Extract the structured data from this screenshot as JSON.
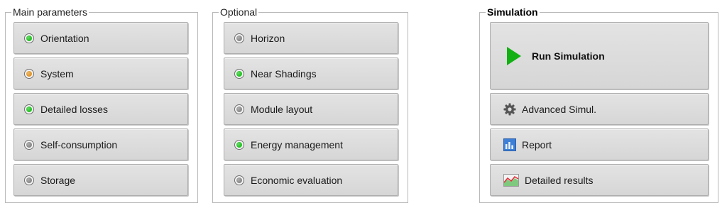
{
  "main": {
    "title": "Main parameters",
    "items": [
      {
        "label": "Orientation",
        "status": "green"
      },
      {
        "label": "System",
        "status": "orange"
      },
      {
        "label": "Detailed losses",
        "status": "green"
      },
      {
        "label": "Self-consumption",
        "status": "gray"
      },
      {
        "label": "Storage",
        "status": "gray"
      }
    ]
  },
  "optional": {
    "title": "Optional",
    "items": [
      {
        "label": "Horizon",
        "status": "gray"
      },
      {
        "label": "Near Shadings",
        "status": "green"
      },
      {
        "label": "Module layout",
        "status": "gray"
      },
      {
        "label": "Energy management",
        "status": "green"
      },
      {
        "label": "Economic evaluation",
        "status": "gray"
      }
    ]
  },
  "simulation": {
    "title": "Simulation",
    "run_label": "Run Simulation",
    "advanced_label": "Advanced Simul.",
    "report_label": "Report",
    "results_label": "Detailed results"
  },
  "colors": {
    "green": "#22c322",
    "orange": "#e0962a",
    "gray": "#8a8a8a",
    "play": "#12b012"
  }
}
